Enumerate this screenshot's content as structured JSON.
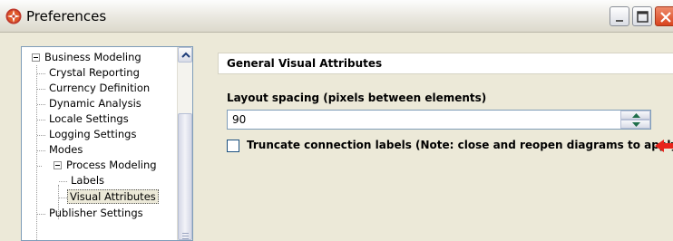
{
  "window": {
    "title": "Preferences",
    "icon": "preferences-app-icon",
    "controls": [
      "minimize-icon",
      "maximize-icon",
      "close-icon"
    ]
  },
  "tree": {
    "items": [
      {
        "label": "Business Modeling",
        "expanded": true
      },
      {
        "label": "Crystal Reporting"
      },
      {
        "label": "Currency Definition"
      },
      {
        "label": "Dynamic Analysis"
      },
      {
        "label": "Locale Settings"
      },
      {
        "label": "Logging Settings"
      },
      {
        "label": "Modes"
      },
      {
        "label": "Process Modeling",
        "expanded": true
      },
      {
        "label": "Labels"
      },
      {
        "label": "Visual Attributes",
        "selected": true
      },
      {
        "label": "Publisher Settings"
      }
    ]
  },
  "panel": {
    "section_title": "General Visual Attributes",
    "spacing_label": "Layout spacing (pixels between elements)",
    "spacing_value": "90",
    "truncate_label": "Truncate connection labels (Note: close and reopen diagrams to apply)",
    "truncate_checked": false
  },
  "colors": {
    "accent_arrow": "#e8231a",
    "window_bg": "#ECE9D8",
    "tree_border": "#7f9db9"
  }
}
